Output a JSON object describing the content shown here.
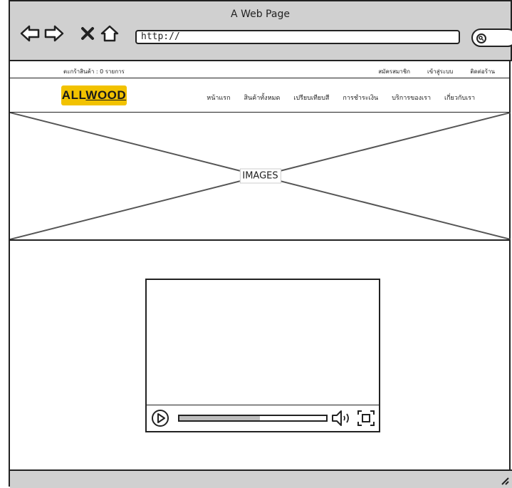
{
  "window": {
    "title": "A Web Page"
  },
  "address_bar": {
    "url": "http://"
  },
  "top_bar": {
    "cart": "ตะกร้าสินค้า : 0 รายการ",
    "links": [
      "สมัครสมาชิก",
      "เข้าสู่ระบบ",
      "ติดต่อร้าน"
    ]
  },
  "header": {
    "logo_part1": "ALL",
    "logo_part2": "WOOD",
    "menu": [
      "หน้าแรก",
      "สินค้าทั้งหมด",
      "เปรียบเทียบสี",
      "การชำระเงิน",
      "บริการของเรา",
      "เกี่ยวกับเรา"
    ]
  },
  "hero": {
    "label": "IMAGES"
  },
  "video": {
    "progress": 0.55
  },
  "colors": {
    "chrome": "#d0d0d0",
    "logo_bg": "#f2c200",
    "progress_fill": "#bdbdbd"
  },
  "icons": [
    "back-arrow-icon",
    "forward-arrow-icon",
    "close-x-icon",
    "home-icon",
    "search-icon",
    "play-icon",
    "volume-icon",
    "fullscreen-icon",
    "resize-grip-icon"
  ]
}
